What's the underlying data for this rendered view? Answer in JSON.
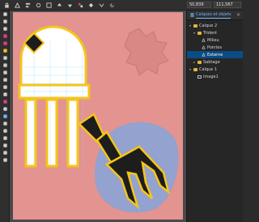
{
  "toolbar": {
    "icons": [
      "lock-icon",
      "snap-icon",
      "align-icon",
      "node-icon",
      "transform-icon",
      "raise-icon",
      "lower-icon",
      "group-icon",
      "flip-icon",
      "flip-v-icon",
      "rotate-icon"
    ],
    "x_value": "50,839",
    "y_value": "111,567"
  },
  "tools": [
    "select",
    "node",
    "zoom",
    "rect",
    "circle",
    "star",
    "spiral",
    "pencil",
    "pen",
    "calligraphy",
    "text",
    "spray",
    "eraser",
    "bucket",
    "gradient",
    "mesh",
    "dropper",
    "connector",
    "measure",
    "tweak",
    "pages"
  ],
  "panel": {
    "tab_label": "Calques et objets",
    "layers": [
      {
        "label": "Calque 2",
        "depth": 0,
        "kind": "folder",
        "expanded": true,
        "selected": false
      },
      {
        "label": "Trident",
        "depth": 1,
        "kind": "folder",
        "expanded": true,
        "selected": false
      },
      {
        "label": "Milieu",
        "depth": 2,
        "kind": "path",
        "selected": false
      },
      {
        "label": "Pointes",
        "depth": 2,
        "kind": "path",
        "selected": false
      },
      {
        "label": "Externe",
        "depth": 2,
        "kind": "path",
        "selected": true
      },
      {
        "label": "Sabtage",
        "depth": 1,
        "kind": "folder",
        "expanded": false,
        "selected": false
      },
      {
        "label": "Calque 1",
        "depth": 0,
        "kind": "folder",
        "expanded": true,
        "selected": false
      },
      {
        "label": "image1",
        "depth": 1,
        "kind": "image",
        "selected": false
      }
    ]
  },
  "colors": {
    "canvas_pink": "#e39390",
    "water_blue": "#93a2cf",
    "outline_yellow": "#f5c518",
    "selection_blue": "#0b4b86",
    "accent": "#6fb3ff"
  }
}
